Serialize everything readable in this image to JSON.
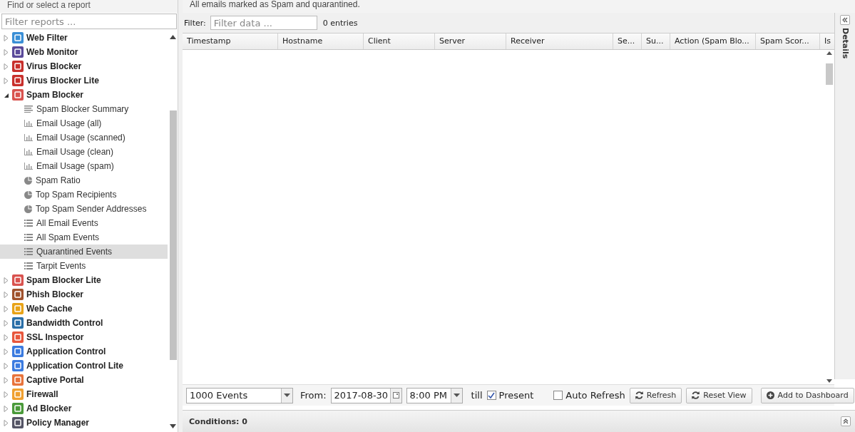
{
  "sidebar": {
    "title": "Find or select a report",
    "filter_placeholder": "Filter reports ...",
    "apps": [
      {
        "name": "Web Filter",
        "expanded": false,
        "color": "#3a8fd6"
      },
      {
        "name": "Web Monitor",
        "expanded": false,
        "color": "#5a4a9a"
      },
      {
        "name": "Virus Blocker",
        "expanded": false,
        "color": "#c8302c"
      },
      {
        "name": "Virus Blocker Lite",
        "expanded": false,
        "color": "#c8302c"
      },
      {
        "name": "Spam Blocker",
        "expanded": true,
        "color": "#d9534f",
        "children": [
          {
            "label": "Spam Blocker Summary",
            "kind": "summary",
            "selected": false
          },
          {
            "label": "Email Usage (all)",
            "kind": "bar",
            "selected": false
          },
          {
            "label": "Email Usage (scanned)",
            "kind": "bar",
            "selected": false
          },
          {
            "label": "Email Usage (clean)",
            "kind": "bar",
            "selected": false
          },
          {
            "label": "Email Usage (spam)",
            "kind": "bar",
            "selected": false
          },
          {
            "label": "Spam Ratio",
            "kind": "pie",
            "selected": false
          },
          {
            "label": "Top Spam Recipients",
            "kind": "pie",
            "selected": false
          },
          {
            "label": "Top Spam Sender Addresses",
            "kind": "pie",
            "selected": false
          },
          {
            "label": "All Email Events",
            "kind": "list",
            "selected": false
          },
          {
            "label": "All Spam Events",
            "kind": "list",
            "selected": false
          },
          {
            "label": "Quarantined Events",
            "kind": "list",
            "selected": true
          },
          {
            "label": "Tarpit Events",
            "kind": "list",
            "selected": false
          }
        ]
      },
      {
        "name": "Spam Blocker Lite",
        "expanded": false,
        "color": "#d9534f"
      },
      {
        "name": "Phish Blocker",
        "expanded": false,
        "color": "#a0522d"
      },
      {
        "name": "Web Cache",
        "expanded": false,
        "color": "#e8a317"
      },
      {
        "name": "Bandwidth Control",
        "expanded": false,
        "color": "#2a6fa8"
      },
      {
        "name": "SSL Inspector",
        "expanded": false,
        "color": "#e8573c"
      },
      {
        "name": "Application Control",
        "expanded": false,
        "color": "#3b7be0"
      },
      {
        "name": "Application Control Lite",
        "expanded": false,
        "color": "#3b7be0"
      },
      {
        "name": "Captive Portal",
        "expanded": false,
        "color": "#e8743c"
      },
      {
        "name": "Firewall",
        "expanded": false,
        "color": "#f0a030"
      },
      {
        "name": "Ad Blocker",
        "expanded": false,
        "color": "#4a9a3a"
      },
      {
        "name": "Policy Manager",
        "expanded": false,
        "color": "#555566"
      }
    ]
  },
  "report": {
    "description": "All emails marked as Spam and quarantined.",
    "filter_label": "Filter:",
    "filter_placeholder": "Filter data ...",
    "entries": "0 entries",
    "columns": [
      "Timestamp",
      "Hostname",
      "Client",
      "Server",
      "Receiver",
      "Se...",
      "Su...",
      "Action (Spam Blo...",
      "Spam Scor...",
      "Is"
    ]
  },
  "details": {
    "label": "Details"
  },
  "toolbar": {
    "limit": "1000 Events",
    "from_label": "From:",
    "date": "2017-08-30",
    "time": "8:00 PM",
    "till_label": "till",
    "present": {
      "label": "Present",
      "checked": true
    },
    "auto_refresh": {
      "label": "Auto Refresh",
      "checked": false
    },
    "buttons": [
      "Refresh",
      "Reset View",
      "Add to Dashboard"
    ]
  },
  "conditions": {
    "label": "Conditions: 0"
  }
}
